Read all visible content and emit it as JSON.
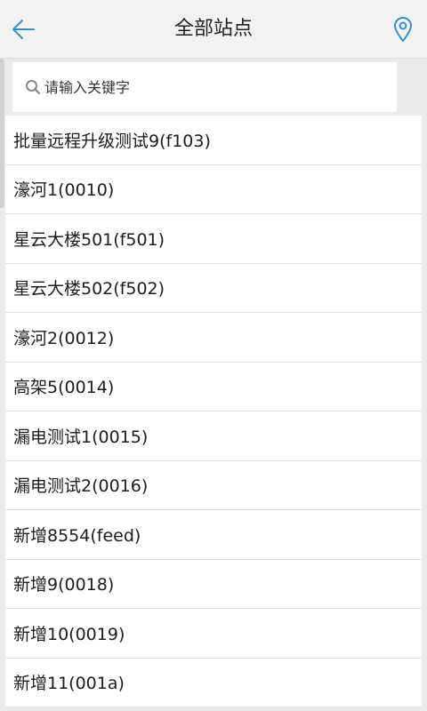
{
  "header": {
    "title": "全部站点",
    "back_icon": "arrow-left-icon",
    "location_icon": "map-pin-icon",
    "accent_color": "#3a8fc7"
  },
  "search": {
    "placeholder": "请输入关键字",
    "value": ""
  },
  "stations": [
    {
      "label": "批量远程升级测试9(f103)"
    },
    {
      "label": "濠河1(0010)"
    },
    {
      "label": "星云大楼501(f501)"
    },
    {
      "label": "星云大楼502(f502)"
    },
    {
      "label": "濠河2(0012)"
    },
    {
      "label": "高架5(0014)"
    },
    {
      "label": "漏电测试1(0015)"
    },
    {
      "label": "漏电测试2(0016)"
    },
    {
      "label": "新增8554(feed)"
    },
    {
      "label": "新增9(0018)"
    },
    {
      "label": "新增10(0019)"
    },
    {
      "label": "新增11(001a)"
    }
  ]
}
